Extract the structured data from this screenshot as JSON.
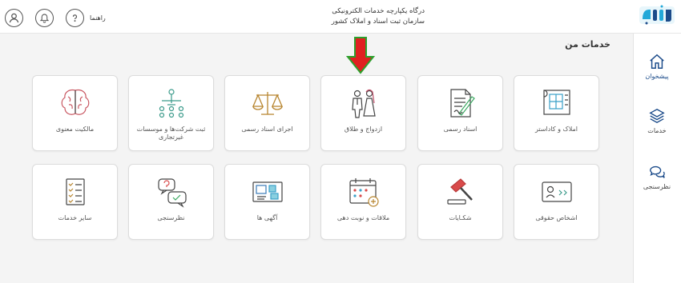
{
  "header": {
    "org_line1": "درگاه یکپارچه خدمات الکترونیکی",
    "org_line2": "سازمان ثبت اسناد و املاک کشور",
    "help_label": "راهنما",
    "icons": [
      "user-icon",
      "bell-icon",
      "help-icon"
    ]
  },
  "sidebar": {
    "items": [
      {
        "label": "پیشخوان",
        "icon": "home-icon",
        "active": true
      },
      {
        "label": "خدمات",
        "icon": "layers-icon",
        "active": false
      },
      {
        "label": "نظرسنجی",
        "icon": "chat-icon",
        "active": false
      }
    ]
  },
  "main": {
    "title": "خدمات من",
    "tiles": [
      {
        "label": "املاک و کاداستر",
        "icon": "cadastre-map-icon"
      },
      {
        "label": "اسناد رسمی",
        "icon": "document-pen-icon"
      },
      {
        "label": "ازدواج و طلاق",
        "icon": "bride-groom-icon"
      },
      {
        "label": "اجرای اسناد رسمی",
        "icon": "scales-icon"
      },
      {
        "label": "ثبت شرکت‌ها و موسسات غیرتجاری",
        "icon": "org-chart-icon"
      },
      {
        "label": "مالکیت معنوی",
        "icon": "brain-icon"
      },
      {
        "label": "اشخاص حقوقی",
        "icon": "id-card-icon"
      },
      {
        "label": "شکـایات",
        "icon": "gavel-icon"
      },
      {
        "label": "ملاقات و نوبت دهی",
        "icon": "calendar-icon"
      },
      {
        "label": "آگهی ها",
        "icon": "notice-board-icon"
      },
      {
        "label": "نظرسنجی",
        "icon": "survey-bubbles-icon"
      },
      {
        "label": "سایر خدمات",
        "icon": "checklist-icon"
      }
    ]
  },
  "colors": {
    "accent": "#1b4b8a",
    "annotation_arrow": "#e02020",
    "arrow_outline": "#2ca02c"
  }
}
